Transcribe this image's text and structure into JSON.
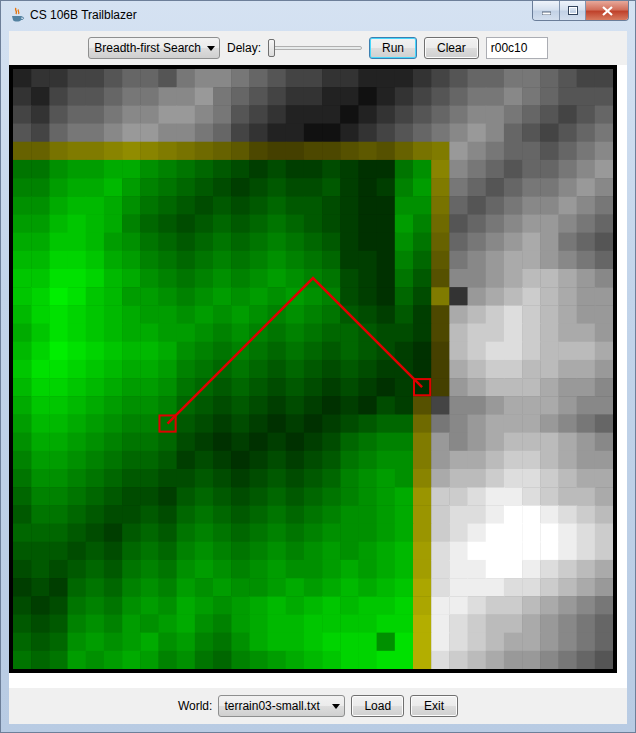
{
  "window": {
    "title": "CS 106B Trailblazer"
  },
  "toolbar": {
    "algorithm": "Breadth-first Search",
    "delay_label": "Delay:",
    "delay": {
      "level": 0
    },
    "buttons": [
      {
        "label": "Run",
        "focused": true
      },
      {
        "label": "Clear",
        "focused": false
      }
    ],
    "cell_field": "r00c10"
  },
  "terrain": {
    "rows": 33,
    "cols": 33,
    "elevation": [
      "233445665788765443322234566776544",
      "324556778897654332212345677876555",
      "435667889987543222123456788765456",
      "546778998876432211234567898654567",
      "557889a98765421122343578987665678",
      "66899aa87654323223211689876566789",
      "779aab976543234334212798765677898",
      "88abba865434345443211887656788987",
      "99bcba754345456543211976567899876",
      "aaccb98654565676542118656789a9765",
      "bbddca976567678765221754789aa9876",
      "cceedba876787898763216438 9abba987",
      "cdfecb99878989898732153 39abcba998",
      "bdedcba99898987876432422abcdcba99",
      "acedcbaa9987876765543322bccdcbaa9",
      "bdfedcbba876765654543211bcddcbbba",
      "ceedcbaa9765654543432211abccbbaa9",
      "bddcba9986545434323212119abbba998",
      "accba98875434323212132348 9aaa9887",
      "9bba9877643232121234556789aaa9876",
      "8aa987665321212123567789 9abbba987",
      "799876554232123234678 89aabccba998",
      "688765443343234345789 9abbcddcbaa9",
      "577654332454345456789abccdeedcbba",
      "466543343565456567 89abcddeffedcbb",
      "555432454676567678 89abcdeffffedcbb",
      "444343565787678789 9abcdefffffedcba",
      "343454676898789 89a9abcdeeffedcba9",
      "232565787989 89a9ababcddeeeddcba98",
      "323676898a989ababcbccddeedccba987",
      "434787989a879abbccccddeedcbba9876",
      "5458989a89768abbcddd eeedcbaa98765",
      "656989a978657 9abcddeeedcba9987654"
    ],
    "state": [
      ".................................",
      ".................................",
      ".................................",
      ".................................",
      "yyyyyyyyyyyyyyyyyyyyyyyy.........",
      "gggggggggggggggggggggggy.........",
      "gggggggggggggggggggggggy.........",
      "gggggggggggggggggggggggy.........",
      "gggggggggggggggggggggggy.........",
      "gggggggggggggggggggggggy.........",
      "gggggggggggggggggggggggy.........",
      "gggggggggggggggggggggggy.........",
      "gggggggggggggggggggggggy.........",
      "gggggggggggggggggggggggy.........",
      "gggggggggggggggggggggggy.........",
      "gggggggggggggggggggggggy.........",
      "gggggggggggggggggggggggy.........",
      "gggggggggggggggggggggggy.........",
      "ggggggggggggggggggggggy..........",
      "ggggggggggggggggggggggy..........",
      "ggggggggggggggggggggggy..........",
      "ggggggggggggggggggggggy..........",
      "ggggggggggggggggggggggy..........",
      "ggggggggggggggggggggggy..........",
      "ggggggggggggggggggggggy..........",
      "ggggggggggggggggggggggy..........",
      "ggggggggggggggggggggggy..........",
      "ggggggggggggggggggggggy..........",
      "ggggggggggggggggggggggy..........",
      "ggggggggggggggggggggggy..........",
      "ggggggggggggggggggggggy..........",
      "ggggggggggggggggggggggy..........",
      "ggggggggggggggggggggggy.........."
    ]
  },
  "path": {
    "cells": [
      [
        19,
        8
      ],
      [
        11,
        16
      ],
      [
        17,
        22
      ]
    ],
    "markers": [
      [
        19,
        8
      ],
      [
        17,
        22
      ]
    ]
  },
  "bottom_bar": {
    "world_label": "World:",
    "world": "terrain03-small.txt",
    "buttons": [
      "Load",
      "Exit"
    ]
  }
}
